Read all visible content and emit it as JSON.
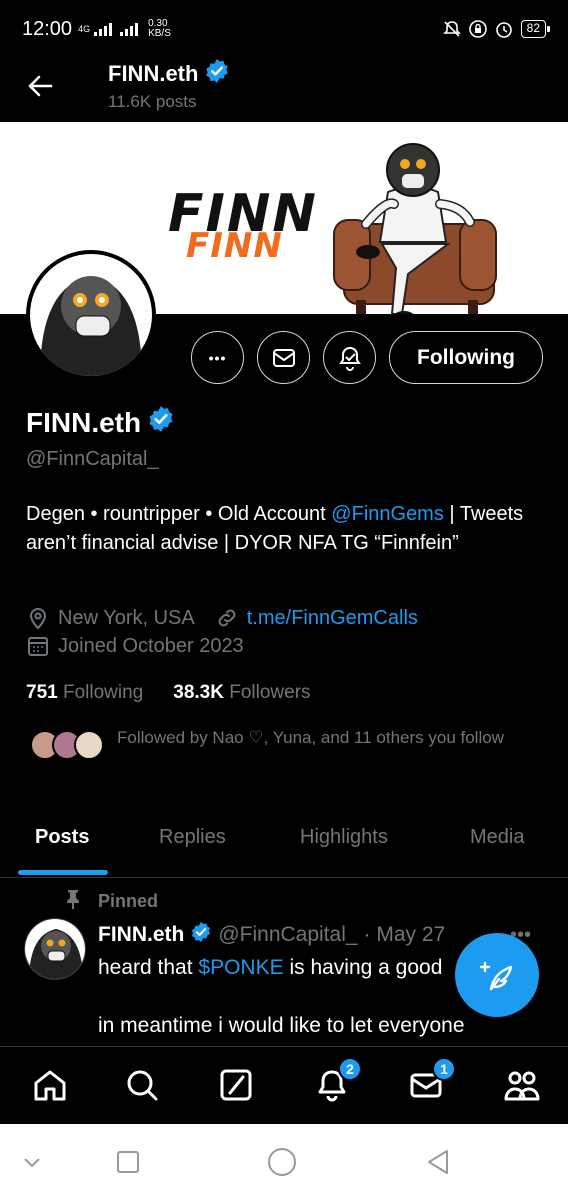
{
  "status_bar": {
    "time": "12:00",
    "network": "4G",
    "speed_value": "0.30",
    "speed_unit": "KB/S",
    "battery": "82"
  },
  "header": {
    "title": "FINN.eth",
    "posts_count": "11.6K posts"
  },
  "banner": {
    "logo_main": "FINN",
    "logo_sub": "FINN"
  },
  "actions": {
    "more_label": "•••",
    "follow_label": "Following"
  },
  "profile": {
    "name": "FINN.eth",
    "handle": "@FinnCapital_",
    "bio_part1": "Degen • rountripper • Old Account ",
    "bio_link": "@FinnGems",
    "bio_part2": " | Tweets aren’t financial advise | DYOR NFA TG “Finnfein”",
    "location": "New York, USA",
    "website": "t.me/FinnGemCalls",
    "joined": "Joined October 2023",
    "following_count": "751",
    "following_label": "Following",
    "followers_count": "38.3K",
    "followers_label": "Followers",
    "followed_by": "Followed by Nao ♡, Yuna, and 11 others you follow"
  },
  "tabs": [
    {
      "label": "Posts"
    },
    {
      "label": "Replies"
    },
    {
      "label": "Highlights"
    },
    {
      "label": "Media"
    }
  ],
  "pinned_post": {
    "pinned_label": "Pinned",
    "name": "FINN.eth",
    "handle": "@FinnCapital_",
    "date": "· May 27",
    "text1_pre": "heard that ",
    "text1_link": "$PONKE",
    "text1_post": " is having a good",
    "text2": "in meantime i would like to let everyone"
  },
  "bottom_nav": {
    "notifications_badge": "2",
    "messages_badge": "1"
  },
  "colors": {
    "accent": "#1d9bf0",
    "background": "#000000",
    "muted": "#71767b",
    "brand_orange": "#f26b1d"
  }
}
